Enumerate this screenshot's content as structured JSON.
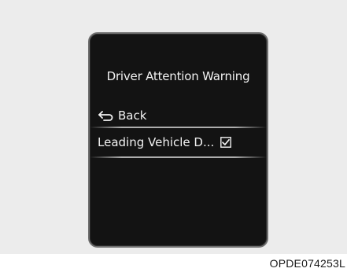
{
  "cluster_screen": {
    "title": "Driver Attention Warning",
    "menu": {
      "back_label": "Back",
      "back_icon": "back-arrow-icon",
      "selected_item_label": "Leading Vehicle D...",
      "selected_item_checked": true,
      "check_icon": "checkbox-checked-icon"
    }
  },
  "figure_code": "OPDE074253L",
  "colors": {
    "screen_background": "#131313",
    "screen_bezel": "#6e6e6e",
    "text": "#f2f2f2",
    "page_backdrop": "#ececec"
  }
}
